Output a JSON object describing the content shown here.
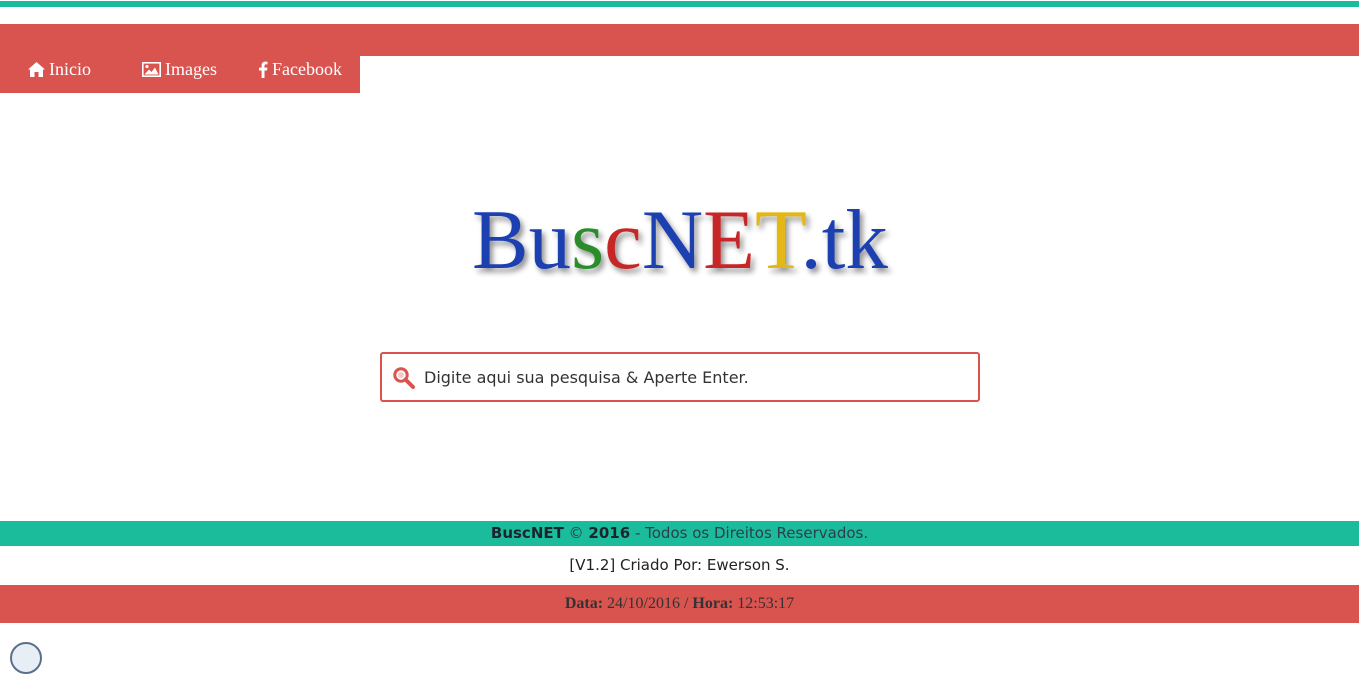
{
  "nav": {
    "items": [
      {
        "label": "Inicio",
        "icon": "home-icon"
      },
      {
        "label": "Images",
        "icon": "image-icon"
      },
      {
        "label": "Facebook",
        "icon": "facebook-icon"
      }
    ]
  },
  "logo": {
    "text": "BuscNET.tk",
    "letters": [
      {
        "char": "B",
        "color": "#1f3fb0"
      },
      {
        "char": "u",
        "color": "#1f3fb0"
      },
      {
        "char": "s",
        "color": "#2a8c2a"
      },
      {
        "char": "c",
        "color": "#c72525"
      },
      {
        "char": "N",
        "color": "#1f3fb0"
      },
      {
        "char": "E",
        "color": "#c72525"
      },
      {
        "char": "T",
        "color": "#e3b814"
      },
      {
        "char": ".",
        "color": "#1f3fb0"
      },
      {
        "char": "t",
        "color": "#1f3fb0"
      },
      {
        "char": "k",
        "color": "#1f3fb0"
      }
    ]
  },
  "search": {
    "placeholder": "Digite aqui sua pesquisa & Aperte Enter.",
    "value": ""
  },
  "footer": {
    "brand": "BuscNET",
    "copyright_symbol": "©",
    "year": "2016",
    "rights": "- Todos os Direitos Reservados.",
    "credits": "[V1.2] Criado Por: Ewerson S.",
    "date_label": "Data:",
    "date_value": "24/10/2016",
    "separator": "/",
    "time_label": "Hora:",
    "time_value": "12:53:17"
  },
  "colors": {
    "accent_red": "#d9534f",
    "accent_green": "#1abc9c"
  }
}
